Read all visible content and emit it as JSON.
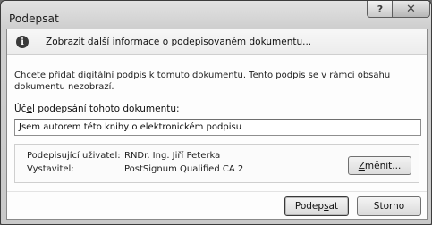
{
  "window": {
    "title": "Podepsat",
    "help_glyph": "?",
    "close_glyph": "✕"
  },
  "infobar": {
    "icon": "info-icon",
    "icon_glyph": "i",
    "link_text": "Zobrazit další informace o podepisovaném dokumentu..."
  },
  "description": "Chcete přidat digitální podpis k tomuto dokumentu. Tento podpis se v rámci obsahu dokumentu nezobrazí.",
  "purpose": {
    "label_pre": "Úč",
    "label_accel": "e",
    "label_post": "l podepsání tohoto dokumentu:",
    "value": "Jsem autorem této knihy o elektronickém podpisu"
  },
  "signer": {
    "user_label": "Podepisující uživatel:",
    "user_value": "RNDr. Ing. Jiří Peterka",
    "issuer_label": "Vystavitel:",
    "issuer_value": "PostSignum Qualified CA 2",
    "change_accel": "Z",
    "change_rest": "měnit..."
  },
  "buttons": {
    "sign_pre": "Podep",
    "sign_accel": "s",
    "sign_post": "at",
    "cancel": "Storno"
  }
}
